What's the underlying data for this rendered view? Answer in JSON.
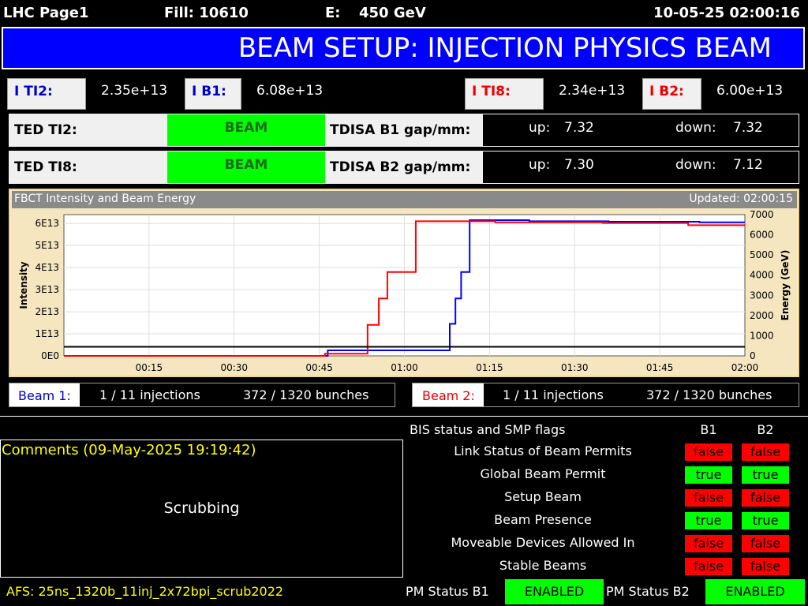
{
  "header": {
    "page": "LHC Page1",
    "fill": "Fill: 10610",
    "energy_label": "E:",
    "energy_value": "450 GeV",
    "datetime": "10-05-25 02:00:16"
  },
  "title": "BEAM SETUP: INJECTION PHYSICS BEAM",
  "intensities": {
    "ti2_label": "I TI2:",
    "ti2_value": "2.35e+13",
    "b1_label": "I B1:",
    "b1_value": "6.08e+13",
    "ti8_label": "I TI8:",
    "ti8_value": "2.34e+13",
    "b2_label": "I B2:",
    "b2_value": "6.00e+13"
  },
  "ted": {
    "ti2_label": "TED TI2:",
    "ti2_status": "BEAM",
    "ti8_label": "TED TI8:",
    "ti8_status": "BEAM"
  },
  "tdisa": {
    "b1_label": "TDISA B1 gap/mm:",
    "b1_up_label": "up:",
    "b1_up": "7.32",
    "b1_down_label": "down:",
    "b1_down": "7.32",
    "b2_label": "TDISA B2 gap/mm:",
    "b2_up_label": "up:",
    "b2_up": "7.30",
    "b2_down_label": "down:",
    "b2_down": "7.12"
  },
  "chart_header": {
    "title": "FBCT Intensity and Beam Energy",
    "updated": "Updated: 02:00:15"
  },
  "chart_data": {
    "type": "line",
    "ylabel": "Intensity",
    "y2label": "Energy (GeV)",
    "ylim": [
      0,
      6.4
    ],
    "y2lim": [
      0,
      7000
    ],
    "xlim": [
      0,
      120
    ],
    "x_ticks": [
      "00:15",
      "00:30",
      "00:45",
      "01:00",
      "01:15",
      "01:30",
      "01:45",
      "02:00"
    ],
    "y_ticks": [
      "0E0",
      "1E13",
      "2E13",
      "3E13",
      "4E13",
      "5E13",
      "6E13"
    ],
    "y2_ticks": [
      "0",
      "1000",
      "2000",
      "3000",
      "4000",
      "5000",
      "6000",
      "7000"
    ],
    "series": [
      {
        "color": "#0000ff",
        "x": [
          0,
          46.5,
          46.5,
          50,
          50,
          68,
          68,
          69,
          69,
          70,
          70,
          71.5,
          71.5,
          82,
          82,
          96,
          96,
          112,
          112,
          120
        ],
        "y": [
          0,
          0,
          0.25,
          0.25,
          0.25,
          0.25,
          1.45,
          1.45,
          2.6,
          2.6,
          3.8,
          3.8,
          6.15,
          6.15,
          6.1,
          6.1,
          6.08,
          6.08,
          6.05,
          6.05
        ]
      },
      {
        "color": "#ff0000",
        "x": [
          0,
          46,
          46,
          53.5,
          53.5,
          55.5,
          55.5,
          57,
          57,
          59,
          59,
          62,
          62,
          76,
          76,
          95,
          95,
          110,
          110,
          120
        ],
        "y": [
          0,
          0,
          0.1,
          0.1,
          1.4,
          1.4,
          2.6,
          2.6,
          3.8,
          3.8,
          3.8,
          3.8,
          6.1,
          6.1,
          6.05,
          6.05,
          6.02,
          6.02,
          5.92,
          5.92
        ]
      },
      {
        "color": "#000000",
        "x": [
          0,
          120
        ],
        "y2": [
          450,
          450
        ]
      }
    ]
  },
  "injections": {
    "beam1_label": "Beam 1:",
    "beam1_inj": "1 / 11 injections",
    "beam1_bunches": "372 / 1320 bunches",
    "beam2_label": "Beam 2:",
    "beam2_inj": "1 / 11 injections",
    "beam2_bunches": "372 / 1320 bunches"
  },
  "comments": {
    "title": "Comments (09-May-2025 19:19:42)",
    "text": "Scrubbing"
  },
  "afs": "AFS: 25ns_1320b_11inj_2x72bpi_scrub2022",
  "bis": {
    "title": "BIS status and SMP flags",
    "col_b1": "B1",
    "col_b2": "B2",
    "rows": [
      {
        "label": "Link Status of Beam Permits",
        "b1": "false",
        "b2": "false"
      },
      {
        "label": "Global Beam Permit",
        "b1": "true",
        "b2": "true"
      },
      {
        "label": "Setup Beam",
        "b1": "false",
        "b2": "false"
      },
      {
        "label": "Beam Presence",
        "b1": "true",
        "b2": "true"
      },
      {
        "label": "Moveable Devices Allowed In",
        "b1": "false",
        "b2": "false"
      },
      {
        "label": "Stable Beams",
        "b1": "false",
        "b2": "false"
      }
    ]
  },
  "pm": {
    "b1_label": "PM Status B1",
    "b1_status": "ENABLED",
    "b2_label": "PM Status B2",
    "b2_status": "ENABLED"
  }
}
